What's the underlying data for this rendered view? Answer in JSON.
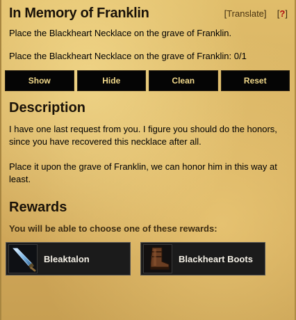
{
  "quest": {
    "title": "In Memory of Franklin",
    "translate_label": "Translate",
    "help_label": "?",
    "objective": "Place the Blackheart Necklace on the grave of Franklin.",
    "progress": "Place the Blackheart Necklace on the grave of Franklin: 0/1"
  },
  "buttons": {
    "show": "Show",
    "hide": "Hide",
    "clean": "Clean",
    "reset": "Reset"
  },
  "description": {
    "heading": "Description",
    "paragraph1": "I have one last request from you. I figure you should do the honors, since you have recovered this necklace after all.",
    "paragraph2": "Place it upon the grave of Franklin, we can honor him in this way at least."
  },
  "rewards": {
    "heading": "Rewards",
    "subtitle": "You will be able to choose one of these rewards:",
    "items": [
      {
        "name": "Bleaktalon",
        "icon": "dagger-icon"
      },
      {
        "name": "Blackheart Boots",
        "icon": "boots-icon"
      }
    ]
  },
  "colors": {
    "parchment": "#d6b061",
    "button_bg": "#050505",
    "button_text": "#f2d98a",
    "reward_bg": "#1b1b1b",
    "help": "#b01010"
  }
}
